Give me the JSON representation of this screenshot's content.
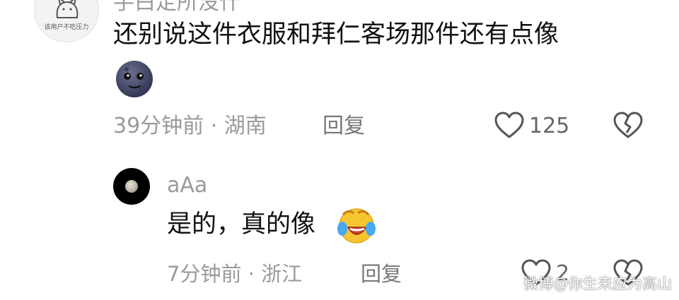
{
  "top_comment": {
    "username": "手白定所没什",
    "avatar_caption": "该用户不吃压力",
    "text": "还别说这件衣服和拜仁客场那件还有点像",
    "emoji": "new-moon-face-emoji",
    "time_location": "39分钟前 · 湖南",
    "reply_label": "回复",
    "like_count": "125"
  },
  "reply_comment": {
    "username": "aAa",
    "text": "是的，真的像",
    "emoji": "laughing-tears-emoji",
    "time_location": "7分钟前 · 浙江",
    "reply_label": "回复",
    "like_count": "2"
  },
  "watermark": "微博@你生来应为高山",
  "colors": {
    "text": "#111111",
    "meta": "#9a9a9a",
    "icon": "#555555"
  }
}
